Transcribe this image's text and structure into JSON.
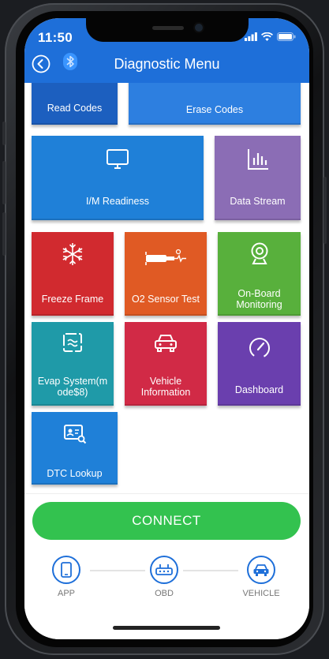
{
  "status_bar": {
    "time": "11:50"
  },
  "header": {
    "title": "Diagnostic Menu"
  },
  "tiles": [
    {
      "label": "Read Codes",
      "icon": "read-codes-icon",
      "color": "#1c5fbf"
    },
    {
      "label": "Erase Codes",
      "icon": "erase-codes-icon",
      "color": "#2d7fe0"
    },
    {
      "label": "I/M Readiness",
      "icon": "monitor-icon",
      "color": "#1f80d8"
    },
    {
      "label": "Data Stream",
      "icon": "bar-chart-icon",
      "color": "#8b6db5"
    },
    {
      "label": "Freeze Frame",
      "icon": "snowflake-icon",
      "color": "#d12a2f"
    },
    {
      "label": "O2 Sensor Test",
      "icon": "o2-sensor-icon",
      "color": "#e05a24"
    },
    {
      "label": "On-Board\nMonitoring",
      "icon": "webcam-icon",
      "color": "#58b03c"
    },
    {
      "label": "Evap System(m\node$8)",
      "icon": "evap-icon",
      "color": "#1f9aa8"
    },
    {
      "label": "Vehicle\nInformation",
      "icon": "car-icon",
      "color": "#d12a46"
    },
    {
      "label": "Dashboard",
      "icon": "gauge-icon",
      "color": "#6a3fae"
    },
    {
      "label": "DTC Lookup",
      "icon": "dtc-lookup-icon",
      "color": "#1f80d8"
    }
  ],
  "connect": {
    "label": "CONNECT"
  },
  "steps": [
    {
      "label": "APP",
      "icon": "phone-icon"
    },
    {
      "label": "OBD",
      "icon": "obd-adapter-icon"
    },
    {
      "label": "VEHICLE",
      "icon": "car-icon"
    }
  ]
}
